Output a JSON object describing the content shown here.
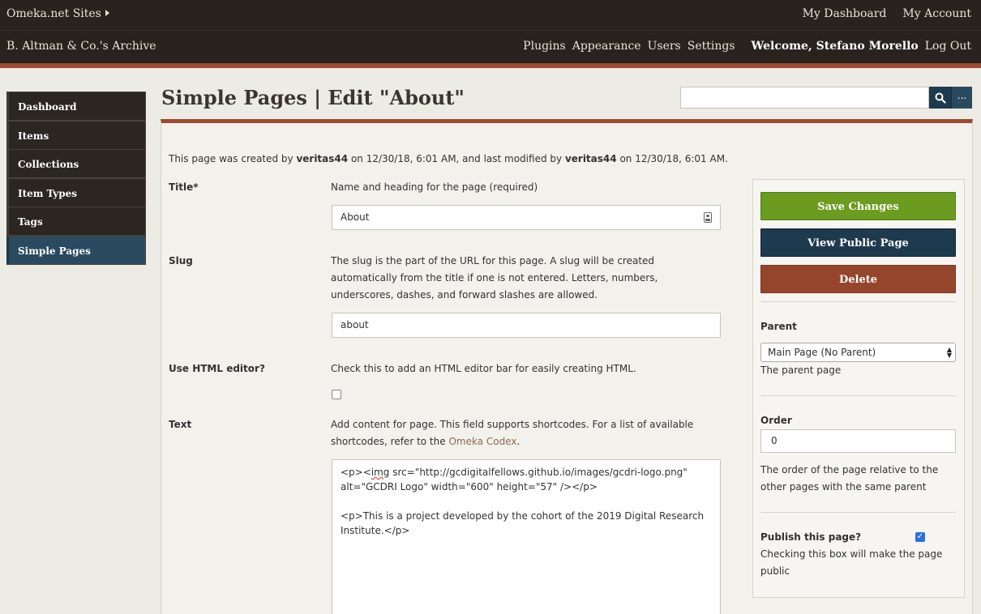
{
  "topbar": {
    "sites_label": "Omeka.net Sites",
    "my_dashboard": "My Dashboard",
    "my_account": "My Account"
  },
  "sitebar": {
    "site_name": "B. Altman & Co.'s Archive",
    "nav": [
      "Plugins",
      "Appearance",
      "Users",
      "Settings"
    ],
    "welcome": "Welcome, Stefano Morello",
    "logout": "Log Out"
  },
  "sidebar": {
    "items": [
      {
        "label": "Dashboard"
      },
      {
        "label": "Items"
      },
      {
        "label": "Collections"
      },
      {
        "label": "Item Types"
      },
      {
        "label": "Tags"
      },
      {
        "label": "Simple Pages"
      }
    ],
    "active": "Simple Pages"
  },
  "page": {
    "title": "Simple Pages | Edit \"About\"",
    "search_placeholder": "",
    "more_label": "..."
  },
  "meta": {
    "prefix": "This page was created by",
    "created_by": "veritas44",
    "mid1": "on 12/30/18, 6:01 AM, and last modified by",
    "modified_by": "veritas44",
    "suffix": "on 12/30/18, 6:01 AM."
  },
  "form": {
    "title_label": "Title*",
    "title_desc": "Name and heading for the page (required)",
    "title_value": "About",
    "slug_label": "Slug",
    "slug_desc": "The slug is the part of the URL for this page. A slug will be created automatically from the title if one is not entered. Letters, numbers, underscores, dashes, and forward slashes are allowed.",
    "slug_value": "about",
    "html_label": "Use HTML editor?",
    "html_desc": "Check this to add an HTML editor bar for easily creating HTML.",
    "text_label": "Text",
    "text_desc_pre": "Add content for page. This field supports shortcodes. For a list of available shortcodes, refer to the",
    "text_desc_link": "Omeka Codex",
    "text_desc_post": ".",
    "text_line1_a": "<p><",
    "text_line1_b": "img",
    "text_line1_c": " src=\"http://gcdigitalfellows.github.io/images/gcdri-logo.png\" alt=\"GCDRI Logo\" width=\"600\" height=\"57\" /></p>",
    "text_line2": "<p>This is a project developed by the cohort of the 2019 Digital Research Institute.</p>"
  },
  "actions": {
    "save": "Save Changes",
    "view": "View Public Page",
    "delete": "Delete"
  },
  "options": {
    "parent_label": "Parent",
    "parent_value": "Main Page (No Parent)",
    "parent_desc": "The parent page",
    "order_label": "Order",
    "order_value": "0",
    "order_desc": "The order of the page relative to the other pages with the same parent",
    "publish_label": "Publish this page?",
    "publish_checked": true,
    "publish_desc": "Checking this box will make the page public"
  }
}
